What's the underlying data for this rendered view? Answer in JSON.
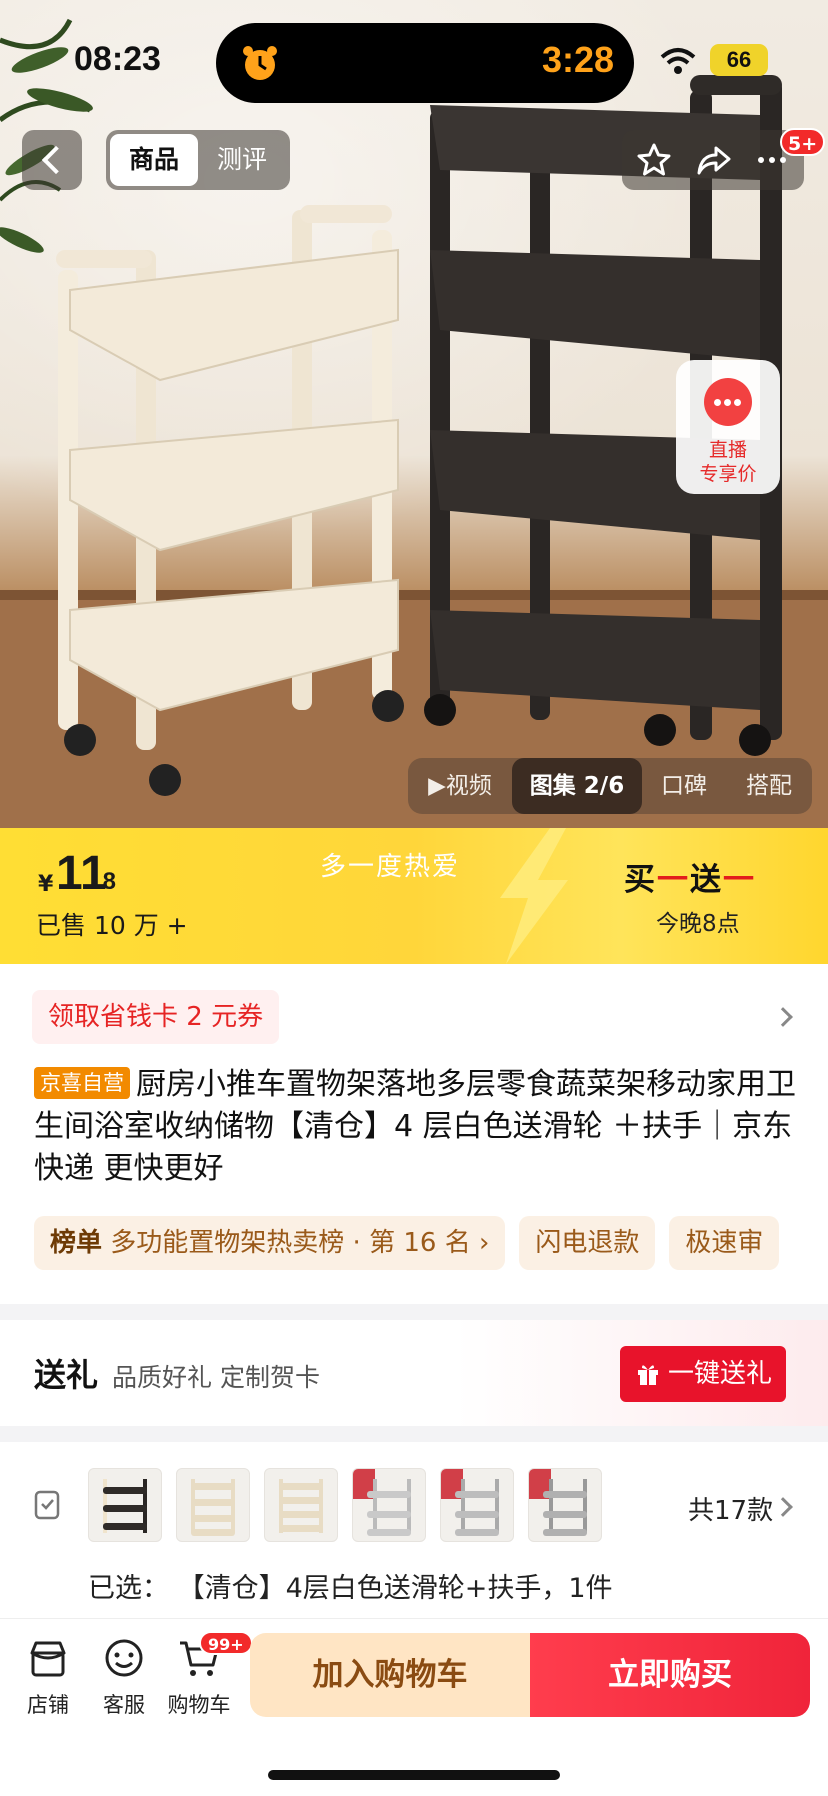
{
  "status": {
    "time": "08:23",
    "timer": "3:28",
    "battery": "66"
  },
  "header": {
    "tabs": [
      "商品",
      "测评"
    ],
    "notif_badge": "5+"
  },
  "live": {
    "line1": "直播",
    "line2": "专享价"
  },
  "media_tabs": {
    "video": "▶视频",
    "gallery": "图集 2/6",
    "review": "口碑",
    "match": "搭配"
  },
  "price": {
    "currency": "¥",
    "integer": "11",
    "decimal": ".8",
    "sold": "已售 10 万 +"
  },
  "banner": {
    "slogan": "多一度热爱",
    "promo_a": "买",
    "promo_dash1": "一",
    "promo_b": "送",
    "promo_dash2": "一",
    "promo_sub": "今晚8点"
  },
  "coupon": "领取省钱卡 2 元券",
  "product": {
    "tag": "京喜自营",
    "title": "厨房小推车置物架落地多层零食蔬菜架移动家用卫生间浴室收纳储物【清仓】4 层白色送滑轮 ＋扶手｜京东快递 更快更好"
  },
  "chips": {
    "rank_tag": "榜单",
    "rank_text": "多功能置物架热卖榜 · 第 16 名",
    "rank_arrow": "›",
    "refund": "闪电退款",
    "review": "极速审"
  },
  "gift": {
    "title": "送礼",
    "subtitle": "品质好礼 定制贺卡",
    "button": "一键送礼"
  },
  "variants": {
    "count": "共17款",
    "selected": "已选：  【清仓】4层白色送滑轮+扶手，1件"
  },
  "bottom": {
    "store": "店铺",
    "service": "客服",
    "cart": "购物车",
    "cart_badge": "99+",
    "add_cart": "加入购物车",
    "buy_now": "立即购买"
  },
  "colors": {
    "accent_red": "#e8132b",
    "banner_yellow": "#ffde34",
    "timer_orange": "#ffa21a"
  }
}
